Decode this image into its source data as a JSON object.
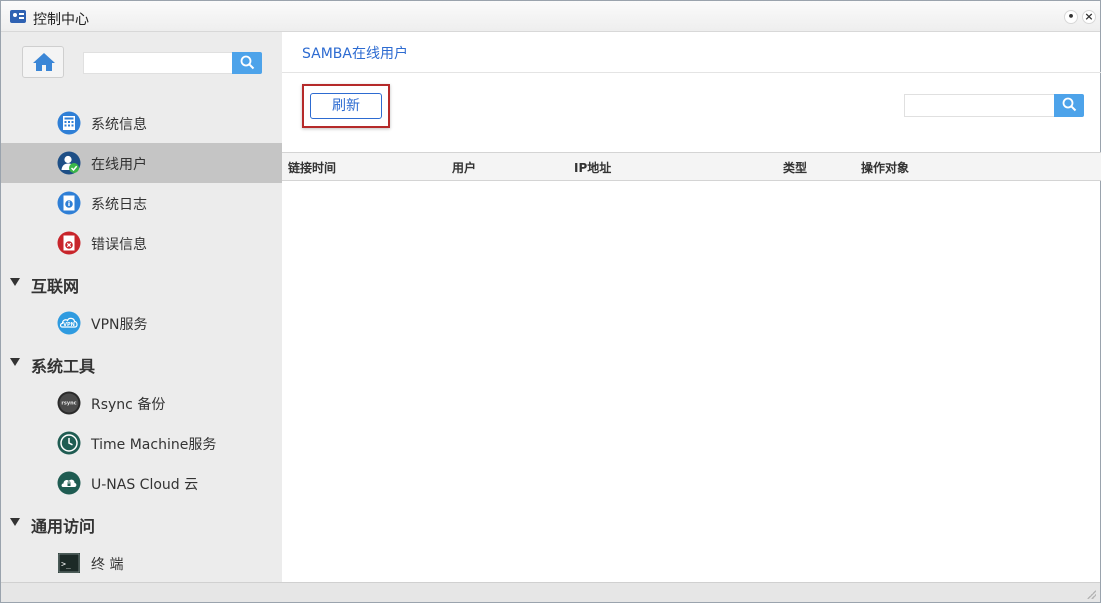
{
  "window": {
    "title": "控制中心",
    "min_label": "•",
    "close_label": "×"
  },
  "sidebar": {
    "search": {
      "value": "",
      "placeholder": ""
    },
    "items": [
      {
        "label": "系统信息",
        "icon": "system-info-icon",
        "active": false
      },
      {
        "label": "在线用户",
        "icon": "online-users-icon",
        "active": true
      },
      {
        "label": "系统日志",
        "icon": "system-log-icon",
        "active": false
      },
      {
        "label": "错误信息",
        "icon": "error-info-icon",
        "active": false
      }
    ],
    "sections": [
      {
        "label": "互联网",
        "items": [
          {
            "label": "VPN服务",
            "icon": "vpn-icon"
          }
        ]
      },
      {
        "label": "系统工具",
        "items": [
          {
            "label": "Rsync 备份",
            "icon": "rsync-icon",
            "icon_text": "rsync"
          },
          {
            "label": "Time Machine服务",
            "icon": "time-machine-icon"
          },
          {
            "label": "U-NAS Cloud 云",
            "icon": "cloud-icon"
          }
        ]
      },
      {
        "label": "通用访问",
        "items": [
          {
            "label": "终 端",
            "icon": "terminal-icon",
            "icon_text": ">_"
          }
        ]
      }
    ]
  },
  "main": {
    "title": "SAMBA在线用户",
    "refresh_label": "刷新",
    "search": {
      "value": "",
      "placeholder": ""
    },
    "table": {
      "columns": [
        "链接时间",
        "用户",
        "IP地址",
        "类型",
        "操作对象"
      ],
      "rows": []
    }
  },
  "colors": {
    "accent": "#2d6bd1",
    "search_button": "#4da3ea",
    "highlight_border": "#b52a2a",
    "sidebar_bg": "#ececec",
    "active_item_bg": "#c5c5c5"
  }
}
